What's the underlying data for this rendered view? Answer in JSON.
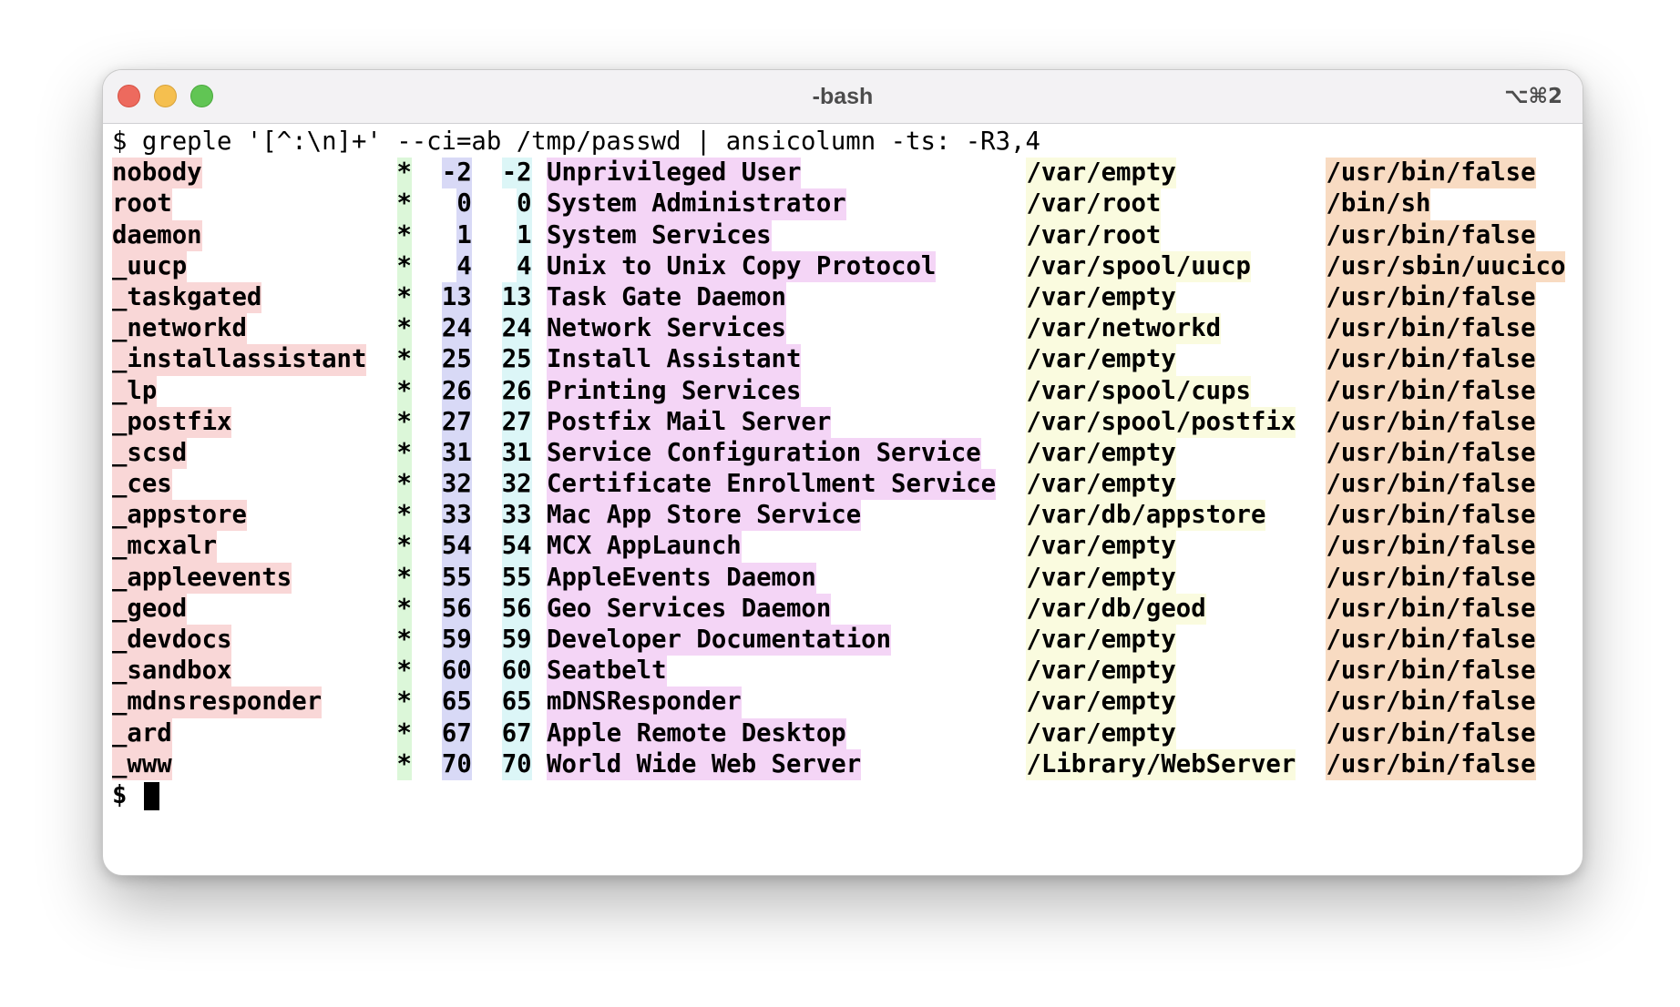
{
  "window": {
    "title": "-bash",
    "shortcut": "⌥⌘2"
  },
  "terminal": {
    "prompt": "$",
    "command": "greple '[^:\\n]+' --ci=ab /tmp/passwd | ansicolumn -ts: -R3,4",
    "rows": [
      {
        "name": "nobody",
        "pw": "*",
        "uid": "-2",
        "gid": "-2",
        "desc": "Unprivileged User",
        "home": "/var/empty",
        "shell": "/usr/bin/false"
      },
      {
        "name": "root",
        "pw": "*",
        "uid": "0",
        "gid": "0",
        "desc": "System Administrator",
        "home": "/var/root",
        "shell": "/bin/sh"
      },
      {
        "name": "daemon",
        "pw": "*",
        "uid": "1",
        "gid": "1",
        "desc": "System Services",
        "home": "/var/root",
        "shell": "/usr/bin/false"
      },
      {
        "name": "_uucp",
        "pw": "*",
        "uid": "4",
        "gid": "4",
        "desc": "Unix to Unix Copy Protocol",
        "home": "/var/spool/uucp",
        "shell": "/usr/sbin/uucico"
      },
      {
        "name": "_taskgated",
        "pw": "*",
        "uid": "13",
        "gid": "13",
        "desc": "Task Gate Daemon",
        "home": "/var/empty",
        "shell": "/usr/bin/false"
      },
      {
        "name": "_networkd",
        "pw": "*",
        "uid": "24",
        "gid": "24",
        "desc": "Network Services",
        "home": "/var/networkd",
        "shell": "/usr/bin/false"
      },
      {
        "name": "_installassistant",
        "pw": "*",
        "uid": "25",
        "gid": "25",
        "desc": "Install Assistant",
        "home": "/var/empty",
        "shell": "/usr/bin/false"
      },
      {
        "name": "_lp",
        "pw": "*",
        "uid": "26",
        "gid": "26",
        "desc": "Printing Services",
        "home": "/var/spool/cups",
        "shell": "/usr/bin/false"
      },
      {
        "name": "_postfix",
        "pw": "*",
        "uid": "27",
        "gid": "27",
        "desc": "Postfix Mail Server",
        "home": "/var/spool/postfix",
        "shell": "/usr/bin/false"
      },
      {
        "name": "_scsd",
        "pw": "*",
        "uid": "31",
        "gid": "31",
        "desc": "Service Configuration Service",
        "home": "/var/empty",
        "shell": "/usr/bin/false"
      },
      {
        "name": "_ces",
        "pw": "*",
        "uid": "32",
        "gid": "32",
        "desc": "Certificate Enrollment Service",
        "home": "/var/empty",
        "shell": "/usr/bin/false"
      },
      {
        "name": "_appstore",
        "pw": "*",
        "uid": "33",
        "gid": "33",
        "desc": "Mac App Store Service",
        "home": "/var/db/appstore",
        "shell": "/usr/bin/false"
      },
      {
        "name": "_mcxalr",
        "pw": "*",
        "uid": "54",
        "gid": "54",
        "desc": "MCX AppLaunch",
        "home": "/var/empty",
        "shell": "/usr/bin/false"
      },
      {
        "name": "_appleevents",
        "pw": "*",
        "uid": "55",
        "gid": "55",
        "desc": "AppleEvents Daemon",
        "home": "/var/empty",
        "shell": "/usr/bin/false"
      },
      {
        "name": "_geod",
        "pw": "*",
        "uid": "56",
        "gid": "56",
        "desc": "Geo Services Daemon",
        "home": "/var/db/geod",
        "shell": "/usr/bin/false"
      },
      {
        "name": "_devdocs",
        "pw": "*",
        "uid": "59",
        "gid": "59",
        "desc": "Developer Documentation",
        "home": "/var/empty",
        "shell": "/usr/bin/false"
      },
      {
        "name": "_sandbox",
        "pw": "*",
        "uid": "60",
        "gid": "60",
        "desc": "Seatbelt",
        "home": "/var/empty",
        "shell": "/usr/bin/false"
      },
      {
        "name": "_mdnsresponder",
        "pw": "*",
        "uid": "65",
        "gid": "65",
        "desc": "mDNSResponder",
        "home": "/var/empty",
        "shell": "/usr/bin/false"
      },
      {
        "name": "_ard",
        "pw": "*",
        "uid": "67",
        "gid": "67",
        "desc": "Apple Remote Desktop",
        "home": "/var/empty",
        "shell": "/usr/bin/false"
      },
      {
        "name": "_www",
        "pw": "*",
        "uid": "70",
        "gid": "70",
        "desc": "World Wide Web Server",
        "home": "/Library/WebServer",
        "shell": "/usr/bin/false"
      }
    ],
    "colors": {
      "name": "#f9d7d7",
      "pw": "#dcf7d9",
      "uid": "#d8d9f6",
      "gid": "#dcf6f7",
      "desc": "#f4d5f6",
      "home": "#fafbdf",
      "shell": "#f8dbc2"
    }
  }
}
